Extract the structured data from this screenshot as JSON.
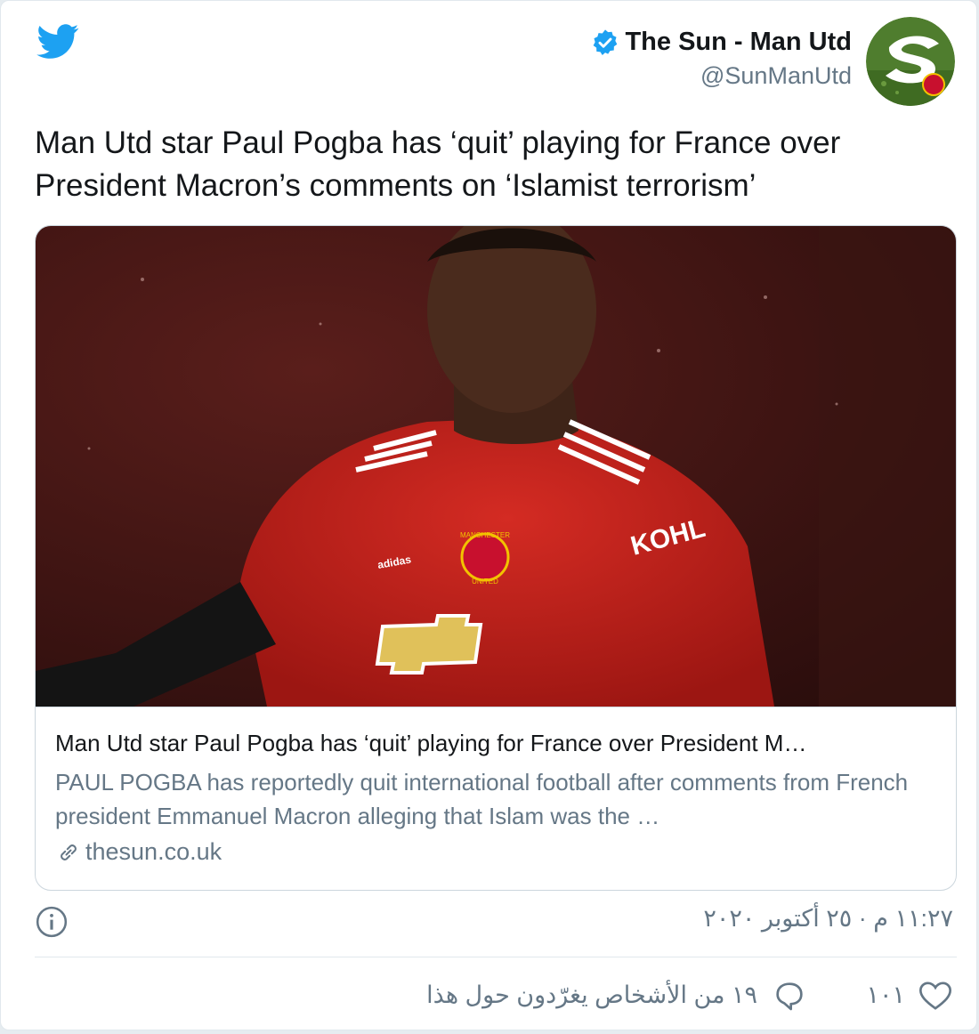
{
  "author": {
    "display_name": "The Sun - Man Utd",
    "handle": "@SunManUtd"
  },
  "tweet": {
    "text": "Man Utd star Paul Pogba has ‘quit’ playing for France over President Macron’s comments on ‘Islamist terrorism’"
  },
  "card": {
    "image_text": {
      "sponsor": "KOHL",
      "kit_brand": "adidas",
      "crest": "MANCHESTER UNITED"
    },
    "title": "Man Utd star Paul Pogba has ‘quit’ playing for France over President M…",
    "description": "PAUL POGBA has reportedly quit international football after comments from French president Emmanuel Macron alleging that Islam was the …",
    "domain": "thesun.co.uk"
  },
  "meta": {
    "timestamp": "١١:٢٧ م · ٢٥ أكتوبر ٢٠٢٠"
  },
  "actions": {
    "like_count": "١٠١",
    "discussion_text": "١٩ من الأشخاص يغرّدون حول هذا"
  },
  "colors": {
    "twitter_blue": "#1da1f2",
    "text_primary": "#14171a",
    "text_secondary": "#657786",
    "border": "#ccd6dd"
  },
  "icons": [
    "twitter-bird-icon",
    "verified-badge-icon",
    "link-icon",
    "info-icon",
    "heart-icon",
    "reply-icon"
  ]
}
